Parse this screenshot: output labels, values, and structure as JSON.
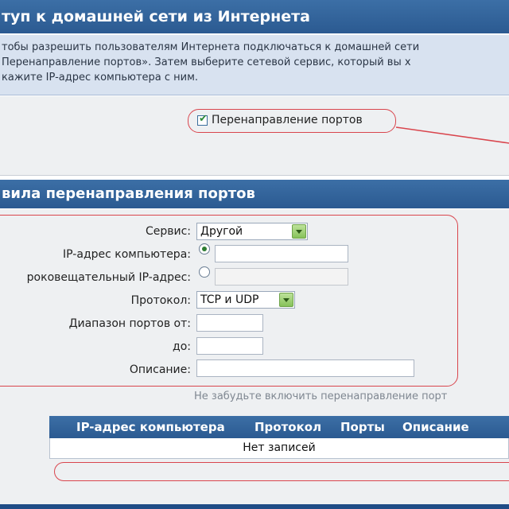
{
  "remote_access": {
    "title": "туп к домашней сети из Интернета",
    "info_lines": [
      "тобы разрешить пользователям Интернета подключаться к домашней сети",
      "Перенаправление портов». Затем выберите сетевой сервис, который вы х",
      "кажите IP-адрес компьютера с ним."
    ],
    "port_forwarding_checkbox_label": "Перенаправление портов",
    "port_forwarding_checked": true
  },
  "rules": {
    "title": "вила перенаправления портов",
    "service_label": "Сервис:",
    "service_value": "Другой",
    "ip_label": "IP-адрес компьютера:",
    "ip_value": "",
    "broadcast_label": "роковещательный IP-адрес:",
    "broadcast_value": "",
    "selected_target": "ip",
    "protocol_label": "Протокол:",
    "protocol_value": "TCP и UDP",
    "port_from_label": "Диапазон портов от:",
    "port_from_value": "",
    "port_to_label": "до:",
    "port_to_value": "",
    "description_label": "Описание:",
    "description_value": "",
    "hint": "Не забудьте включить перенаправление порт"
  },
  "table": {
    "headers": [
      "IP-адрес компьютера",
      "Протокол",
      "Порты",
      "Описание"
    ],
    "empty_text": "Нет записей"
  },
  "colors": {
    "header_bg": "#2f6098",
    "highlight": "#d9454d",
    "check": "#2f8a3a"
  }
}
